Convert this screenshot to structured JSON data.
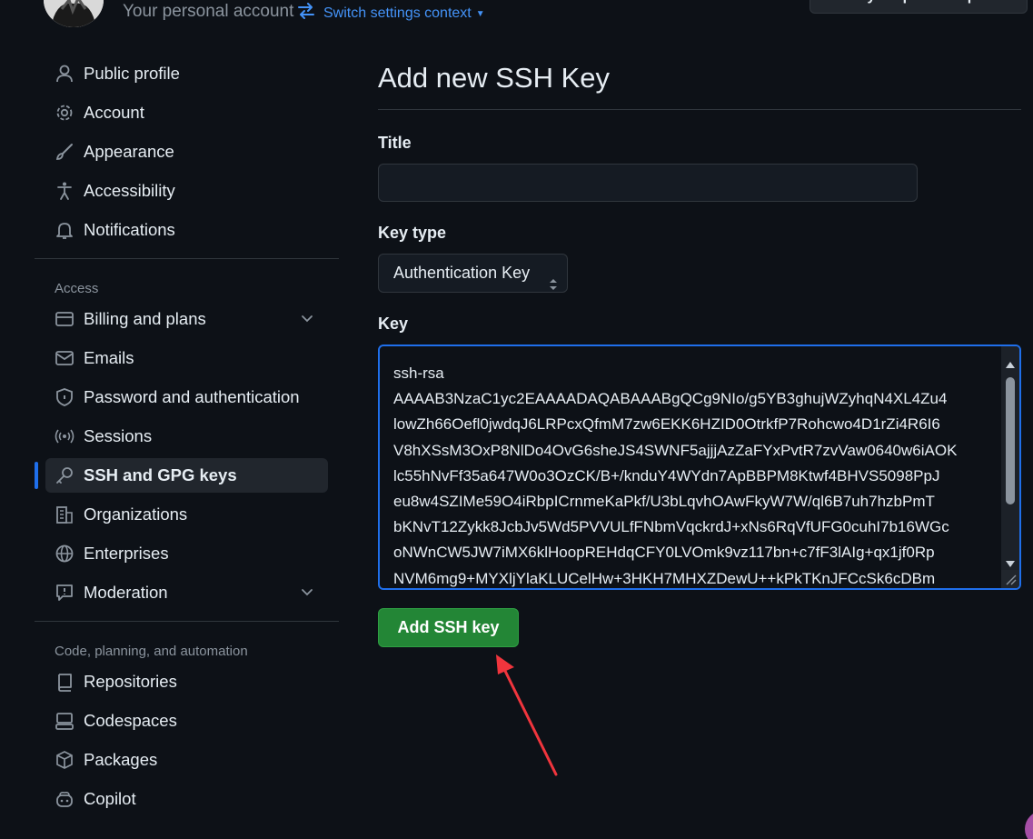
{
  "header": {
    "account_label": "Your personal account",
    "switch_context_label": "Switch settings context",
    "profile_button_label": "Go to your personal profile"
  },
  "sidebar": {
    "top_items": [
      {
        "label": "Public profile",
        "icon": "person-icon"
      },
      {
        "label": "Account",
        "icon": "gear-icon"
      },
      {
        "label": "Appearance",
        "icon": "paintbrush-icon"
      },
      {
        "label": "Accessibility",
        "icon": "accessibility-icon"
      },
      {
        "label": "Notifications",
        "icon": "bell-icon"
      }
    ],
    "access_title": "Access",
    "access_items": [
      {
        "label": "Billing and plans",
        "icon": "credit-card-icon",
        "expandable": true
      },
      {
        "label": "Emails",
        "icon": "mail-icon"
      },
      {
        "label": "Password and authentication",
        "icon": "shield-lock-icon"
      },
      {
        "label": "Sessions",
        "icon": "broadcast-icon"
      },
      {
        "label": "SSH and GPG keys",
        "icon": "key-icon",
        "active": true
      },
      {
        "label": "Organizations",
        "icon": "organization-icon"
      },
      {
        "label": "Enterprises",
        "icon": "globe-icon"
      },
      {
        "label": "Moderation",
        "icon": "report-icon",
        "expandable": true
      }
    ],
    "code_title": "Code, planning, and automation",
    "code_items": [
      {
        "label": "Repositories",
        "icon": "repo-icon"
      },
      {
        "label": "Codespaces",
        "icon": "codespaces-icon"
      },
      {
        "label": "Packages",
        "icon": "package-icon"
      },
      {
        "label": "Copilot",
        "icon": "copilot-icon"
      }
    ]
  },
  "main": {
    "title": "Add new SSH Key",
    "title_field_label": "Title",
    "title_field_value": "",
    "key_type_label": "Key type",
    "key_type_selected": "Authentication Key",
    "key_label": "Key",
    "key_lines": [
      "ssh-rsa",
      "AAAAB3NzaC1yc2EAAAADAQABAAABgQCg9NIo/g5YB3ghujWZyhqN4XL4Zu4",
      "lowZh66Oefl0jwdqJ6LRPcxQfmM7zw6EKK6HZID0OtrkfP7Rohcwo4D1rZi4R6I6",
      "V8hXSsM3OxP8NlDo4OvG6sheJS4SWNF5ajjjAzZaFYxPvtR7zvVaw0640w6iAOK",
      "lc55hNvFf35a647W0o3OzCK/B+/knduY4WYdn7ApBBPM8Ktwf4BHVS5098PpJ",
      "eu8w4SZIMe59O4iRbpICrnmeKaPkf/U3bLqvhOAwFkyW7W/ql6B7uh7hzbPmT",
      "bKNvT12Zykk8JcbJv5Wd5PVVULfFNbmVqckrdJ+xNs6RqVfUFG0cuhI7b16WGc",
      "oNWnCW5JW7iMX6klHoopREHdqCFY0LVOmk9vz117bn+c7fF3lAIg+qx1jf0Rp",
      "NVM6mg9+MYXljYlaKLUCelHw+3HKH7MHXZDewU++kPkTKnJFCcSk6cDBm"
    ],
    "submit_label": "Add SSH key"
  },
  "colors": {
    "background": "#0d1117",
    "accent_blue": "#1f6feb",
    "link_blue": "#4493f8",
    "button_green": "#238636",
    "annotation_red": "#f0353d"
  }
}
